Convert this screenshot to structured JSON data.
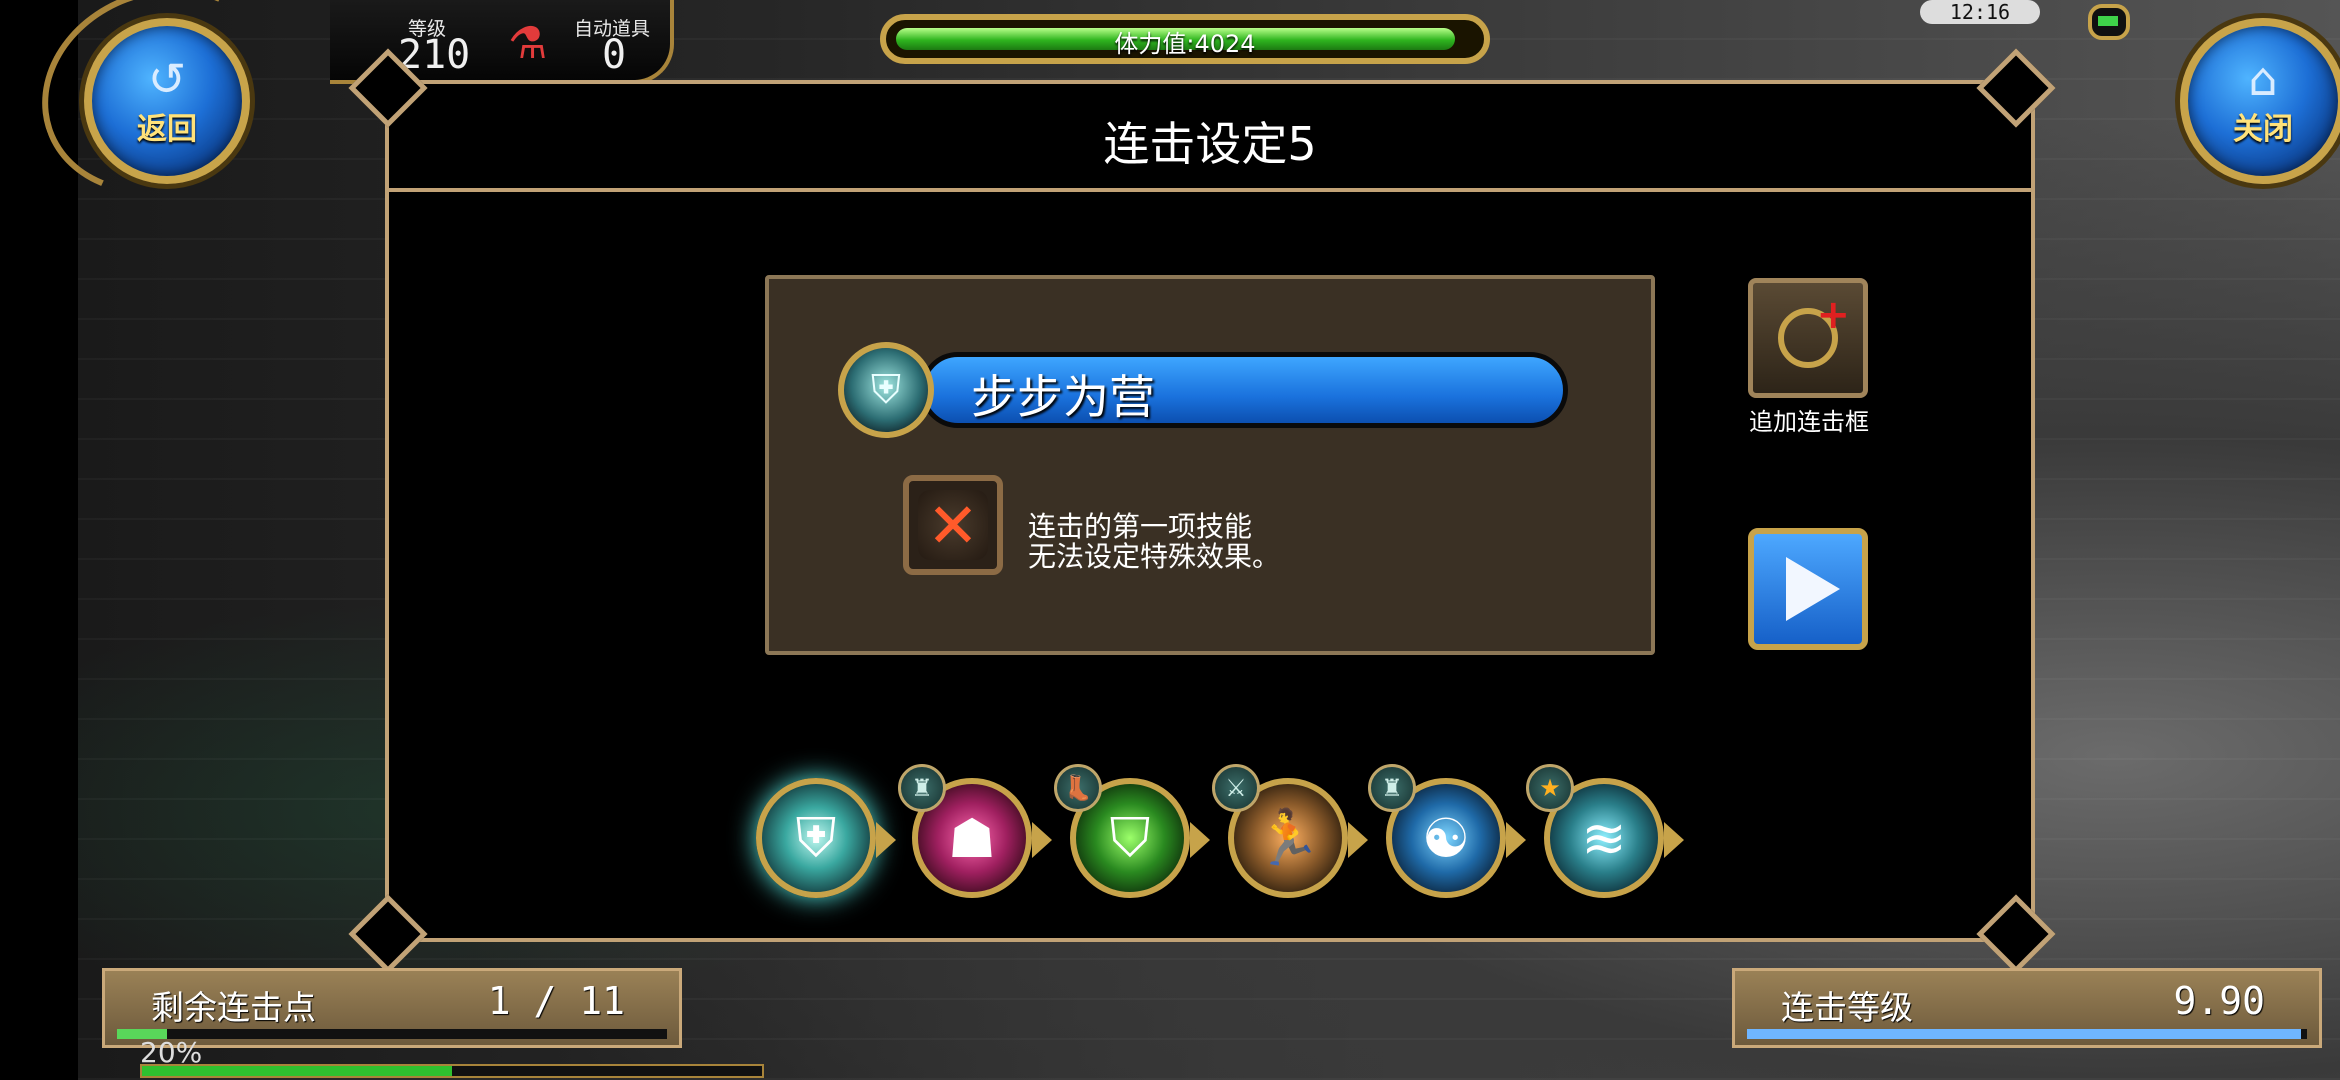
{
  "header": {
    "back_label": "返回",
    "close_label": "关闭",
    "level_label": "等级",
    "level_value": "210",
    "auto_item_label": "自动道具",
    "auto_item_value": "0",
    "stamina_text": "体力值:4024",
    "stamina_fraction": 0.98,
    "clock": "12:16"
  },
  "panel": {
    "title": "连击设定5",
    "skill_name": "步步为营",
    "note_line1": "连击的第一项技能",
    "note_line2": "无法设定特殊效果。",
    "add_combo_label": "追加连击框"
  },
  "combo_skills": [
    {
      "icon": "shield-slash-icon",
      "badge": ""
    },
    {
      "icon": "rage-figure-icon",
      "badge": "potion-icon"
    },
    {
      "icon": "green-shield-icon",
      "badge": "boot-icon"
    },
    {
      "icon": "dash-warrior-icon",
      "badge": "sword-icon"
    },
    {
      "icon": "meditation-icon",
      "badge": "potion-icon"
    },
    {
      "icon": "wind-wave-icon",
      "badge": "star-icon"
    }
  ],
  "footer": {
    "remaining_label": "剩余连击点",
    "remaining_value": "1 / 11",
    "remaining_fraction": 0.09,
    "combo_level_label": "连击等级",
    "combo_level_value": "9.90",
    "combo_level_fraction": 0.99,
    "hp_percent": "20%",
    "hp_fraction": 0.5
  },
  "colors": {
    "gold": "#c7a34a",
    "panel_border": "#c1a276",
    "skill_blue": "#1a72dd"
  }
}
